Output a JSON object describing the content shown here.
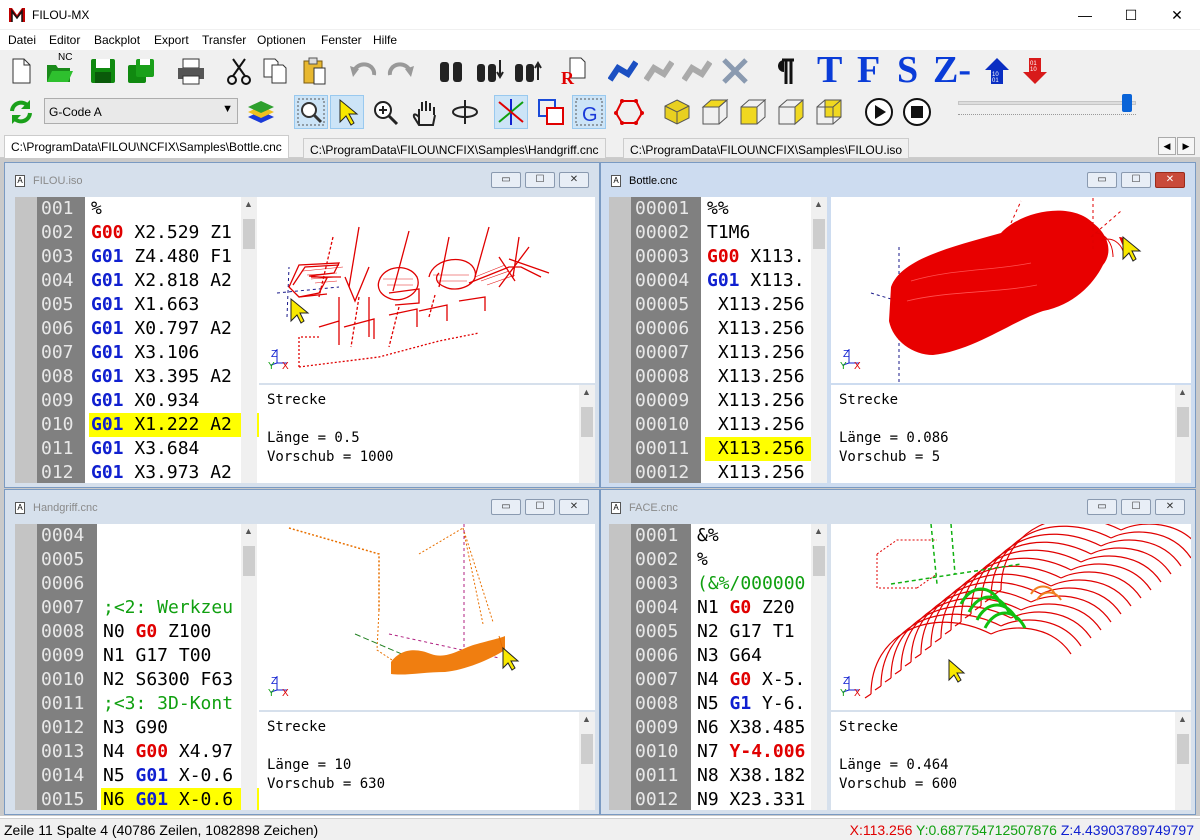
{
  "app": {
    "title": "FILOU-MX",
    "minimize": "—",
    "maximize": "☐",
    "close": "✕"
  },
  "menu": [
    "Datei",
    "Editor",
    "Backplot",
    "Export",
    "Transfer",
    "Optionen",
    "Fenster",
    "Hilfe"
  ],
  "toolbar": {
    "nc_label": "NC",
    "text_buttons": [
      "T",
      "F",
      "S",
      "Z-"
    ],
    "binary_up": "10 01",
    "binary_down": "01 10",
    "mode_select": "G-Code A",
    "slider_value": 0.95
  },
  "tabs": [
    "C:\\ProgramData\\FILOU\\NCFIX\\Samples\\Bottle.cnc",
    "C:\\ProgramData\\FILOU\\NCFIX\\Samples\\Handgriff.cnc",
    "C:\\ProgramData\\FILOU\\NCFIX\\Samples\\FILOU.iso"
  ],
  "windows": [
    {
      "title": "FILOU.iso",
      "numbers": [
        "001",
        "002",
        "003",
        "004",
        "005",
        "006",
        "007",
        "008",
        "009",
        "010",
        "011",
        "012"
      ],
      "code": [
        [
          [
            "",
            "%"
          ]
        ],
        [
          [
            "kr",
            "G00"
          ],
          [
            "",
            " X2.529 Z1"
          ]
        ],
        [
          [
            "kb",
            "G01"
          ],
          [
            "",
            " Z4.480 F1"
          ]
        ],
        [
          [
            "kb",
            "G01"
          ],
          [
            "",
            " X2.818 A2"
          ]
        ],
        [
          [
            "kb",
            "G01"
          ],
          [
            "",
            " X1.663"
          ]
        ],
        [
          [
            "kb",
            "G01"
          ],
          [
            "",
            " X0.797 A2"
          ]
        ],
        [
          [
            "kb",
            "G01"
          ],
          [
            "",
            " X3.106"
          ]
        ],
        [
          [
            "kb",
            "G01"
          ],
          [
            "",
            " X3.395 A2"
          ]
        ],
        [
          [
            "kb",
            "G01"
          ],
          [
            "",
            " X0.934"
          ]
        ],
        [
          [
            "kb",
            "G01"
          ],
          [
            "",
            " X1.222 A2"
          ]
        ],
        [
          [
            "kb",
            "G01"
          ],
          [
            "",
            " X3.684"
          ]
        ],
        [
          [
            "kb",
            "G01"
          ],
          [
            "",
            " X3.973 A2"
          ]
        ]
      ],
      "highlight": 9,
      "info": {
        "label": "Strecke",
        "len": "Länge = 0.5",
        "feed": "Vorschub = 1000"
      }
    },
    {
      "title": "Bottle.cnc",
      "numbers": [
        "00001",
        "00002",
        "00003",
        "00004",
        "00005",
        "00006",
        "00007",
        "00008",
        "00009",
        "00010",
        "00011",
        "00012"
      ],
      "code": [
        [
          [
            "",
            "%%"
          ]
        ],
        [
          [
            "",
            "T1M6"
          ]
        ],
        [
          [
            "kr",
            "G00"
          ],
          [
            "",
            " X113."
          ]
        ],
        [
          [
            "kb",
            "G01"
          ],
          [
            "",
            " X113."
          ]
        ],
        [
          [
            "",
            " X113.256"
          ]
        ],
        [
          [
            "",
            " X113.256"
          ]
        ],
        [
          [
            "",
            " X113.256"
          ]
        ],
        [
          [
            "",
            " X113.256"
          ]
        ],
        [
          [
            "",
            " X113.256"
          ]
        ],
        [
          [
            "",
            " X113.256"
          ]
        ],
        [
          [
            "",
            " X113.256"
          ]
        ],
        [
          [
            "",
            " X113.256"
          ]
        ]
      ],
      "highlight": 10,
      "info": {
        "label": "Strecke",
        "len": "Länge = 0.086",
        "feed": "Vorschub = 5"
      }
    },
    {
      "title": "Handgriff.cnc",
      "numbers": [
        "0004",
        "0005",
        "0006",
        "0007",
        "0008",
        "0009",
        "0010",
        "0011",
        "0012",
        "0013",
        "0014",
        "0015"
      ],
      "code": [
        [
          [
            "",
            ""
          ]
        ],
        [
          [
            "",
            ""
          ]
        ],
        [
          [
            "",
            ""
          ]
        ],
        [
          [
            "kg",
            ";<2: Werkzeu"
          ]
        ],
        [
          [
            "",
            "N0 "
          ],
          [
            "kr",
            "G0"
          ],
          [
            "",
            " Z100"
          ]
        ],
        [
          [
            "",
            "N1 G17 T00"
          ]
        ],
        [
          [
            "",
            "N2 S6300 F63"
          ]
        ],
        [
          [
            "kg",
            ";<3: 3D-Kont"
          ]
        ],
        [
          [
            "",
            "N3 G90"
          ]
        ],
        [
          [
            "",
            "N4 "
          ],
          [
            "kr",
            "G00"
          ],
          [
            "",
            " X4.97"
          ]
        ],
        [
          [
            "",
            "N5 "
          ],
          [
            "kb",
            "G01"
          ],
          [
            "",
            " X-0.6"
          ]
        ],
        [
          [
            "",
            "N6 "
          ],
          [
            "kb",
            "G01"
          ],
          [
            "",
            " X-0.6"
          ]
        ]
      ],
      "highlight": 11,
      "info": {
        "label": "Strecke",
        "len": "Länge = 10",
        "feed": "Vorschub = 630"
      }
    },
    {
      "title": "FACE.cnc",
      "numbers": [
        "0001",
        "0002",
        "0003",
        "0004",
        "0005",
        "0006",
        "0007",
        "0008",
        "0009",
        "0010",
        "0011",
        "0012"
      ],
      "code": [
        [
          [
            "",
            "&%"
          ]
        ],
        [
          [
            "",
            "%"
          ]
        ],
        [
          [
            "kg",
            "(&%/000000"
          ]
        ],
        [
          [
            "",
            "N1 "
          ],
          [
            "kr",
            "G0"
          ],
          [
            "",
            " Z20"
          ]
        ],
        [
          [
            "",
            "N2 G17 T1"
          ]
        ],
        [
          [
            "",
            "N3 G64"
          ]
        ],
        [
          [
            "",
            "N4 "
          ],
          [
            "kr",
            "G0"
          ],
          [
            "",
            " X-5."
          ]
        ],
        [
          [
            "",
            "N5 "
          ],
          [
            "kb",
            "G1"
          ],
          [
            "",
            " Y-6."
          ]
        ],
        [
          [
            "",
            "N6 X38.485"
          ]
        ],
        [
          [
            "",
            "N7 "
          ],
          [
            "kr",
            "Y-4.006"
          ]
        ],
        [
          [
            "",
            "N8 X38.182"
          ]
        ],
        [
          [
            "",
            "N9 X23.331"
          ]
        ]
      ],
      "highlight": -1,
      "info": {
        "label": "Strecke",
        "len": "Länge = 0.464",
        "feed": "Vorschub = 600"
      }
    }
  ],
  "axis": {
    "z": "Z",
    "y": "Y",
    "x": "X"
  },
  "status": {
    "left": "Zeile 11 Spalte 4  (40786 Zeilen, 1082898 Zeichen)",
    "x": "X:113.256",
    "y": "Y:0.687754712507876",
    "z": "Z:4.43903789749797"
  },
  "colors": {
    "x": "#e00000",
    "y": "#10a010",
    "z": "#1020d0"
  }
}
